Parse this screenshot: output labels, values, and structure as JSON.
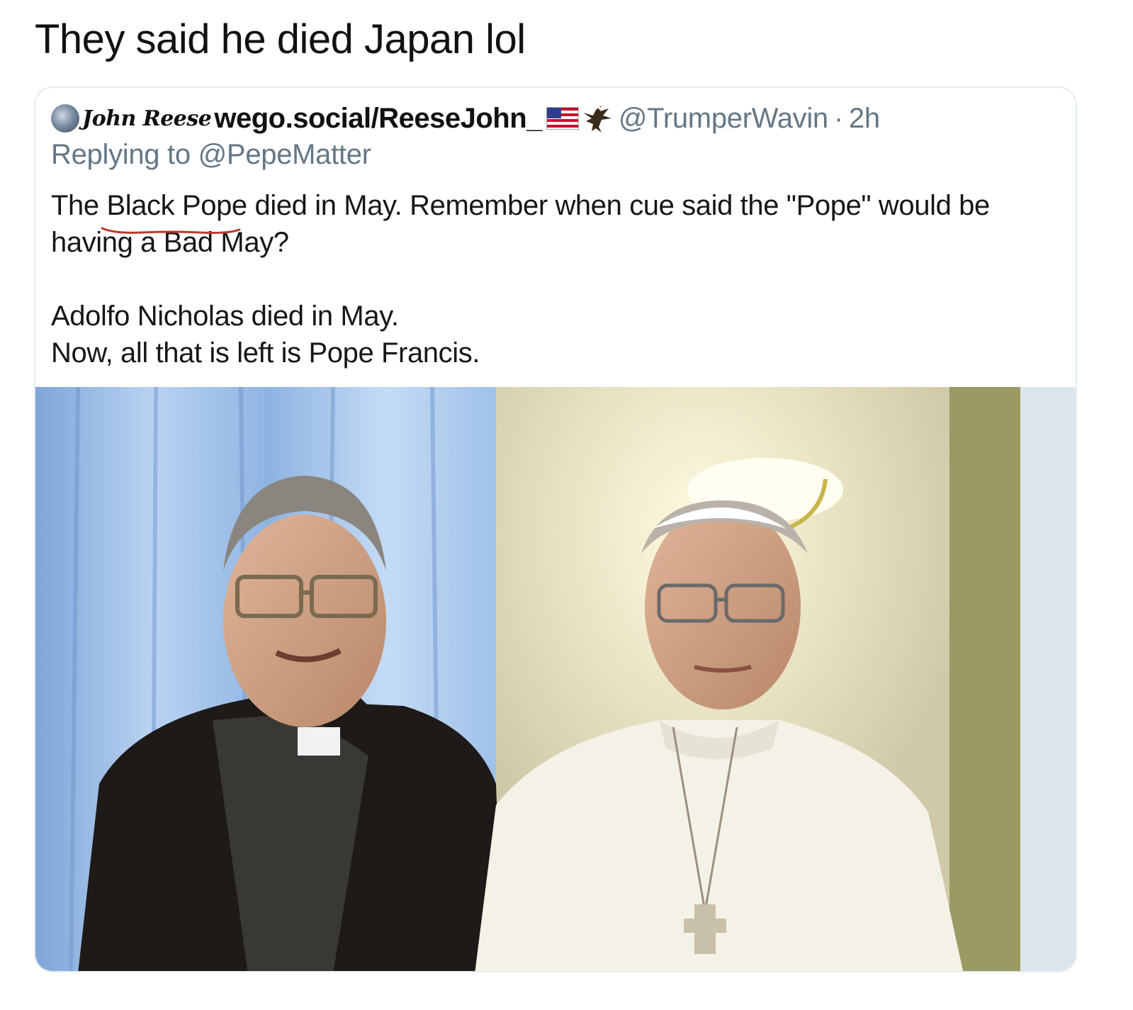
{
  "post": {
    "title": "They said he died Japan lol"
  },
  "tweet": {
    "display_name": "John Reese",
    "name_suffix": "wego.social/ReeseJohn_",
    "handle": "@TrumperWavin",
    "separator": "·",
    "time": "2h",
    "replying_to": "Replying to @PepeMatter",
    "body_line_1": "The Black Pope died in May. Remember when cue said the \"Pope\" would be",
    "body_line_2": "having a Bad May?",
    "body_line_3": "Adolfo Nicholas died in May.",
    "body_line_4": "Now, all that is left is Pope Francis.",
    "icons": [
      "globe-avatar",
      "us-flag-icon",
      "eagle-icon"
    ],
    "accent_color": "#657786",
    "underline_color": "#c0392b"
  }
}
